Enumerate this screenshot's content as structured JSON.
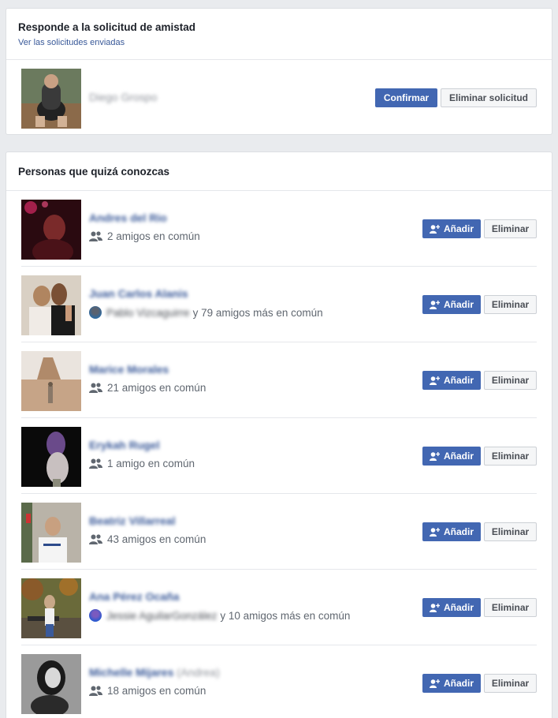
{
  "requests": {
    "title": "Responde a la solicitud de amistad",
    "sent_link": "Ver las solicitudes enviadas",
    "items": [
      {
        "name": "Diego Grospo",
        "confirm_label": "Confirmar",
        "delete_label": "Eliminar solicitud"
      }
    ]
  },
  "suggestions": {
    "title": "Personas que quizá conozcas",
    "add_label": "Añadir",
    "remove_label": "Eliminar",
    "items": [
      {
        "name": "Andres del Rio",
        "name_suffix": "",
        "mutual_friend": "",
        "mutual_text": "2 amigos en común"
      },
      {
        "name": "Juan Carlos Alanis",
        "name_suffix": "",
        "mutual_friend": "Pablo Vizcaguirre",
        "mutual_text": "y 79 amigos más en común"
      },
      {
        "name": "Marice Morales",
        "name_suffix": "",
        "mutual_friend": "",
        "mutual_text": "21 amigos en común"
      },
      {
        "name": "Erykah Rugel",
        "name_suffix": "",
        "mutual_friend": "",
        "mutual_text": "1 amigo en común"
      },
      {
        "name": "Beatriz Villarreal",
        "name_suffix": "",
        "mutual_friend": "",
        "mutual_text": "43 amigos en común"
      },
      {
        "name": "Ana Pérez Ocaña",
        "name_suffix": "",
        "mutual_friend": "Jessie AguilarGonzález",
        "mutual_text": "y 10 amigos más en común"
      },
      {
        "name": "Michelle Mijares",
        "name_suffix": "(Andrea)",
        "mutual_friend": "",
        "mutual_text": "18 amigos en común"
      }
    ]
  },
  "colors": {
    "primary": "#4267b2",
    "link": "#385898",
    "background": "#e9ebee"
  }
}
